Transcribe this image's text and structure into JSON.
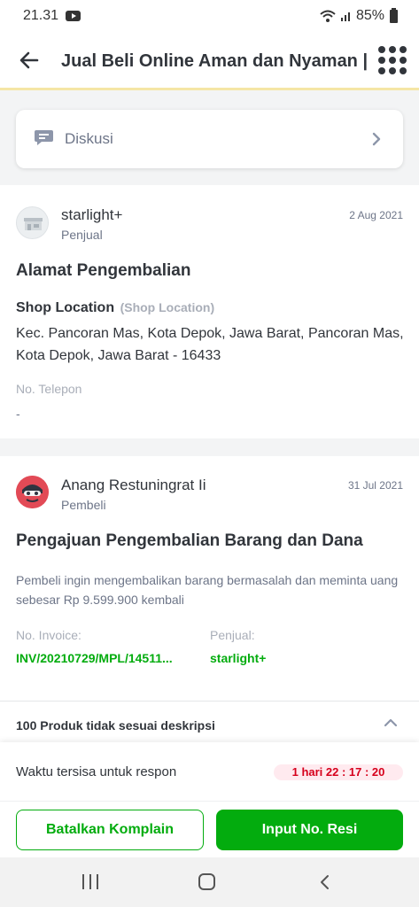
{
  "status_bar": {
    "time": "21.31",
    "battery": "85%"
  },
  "app_bar": {
    "title": "Jual Beli Online Aman dan Nyaman |..."
  },
  "discussion": {
    "label": "Diskusi"
  },
  "seller_post": {
    "name": "starlight+",
    "role": "Penjual",
    "date": "2 Aug 2021",
    "title": "Alamat Pengembalian",
    "shop_location": "Shop Location",
    "shop_location_sub": "(Shop Location)",
    "address": "Kec. Pancoran Mas, Kota Depok, Jawa Barat, Pancoran Mas, Kota Depok, Jawa Barat - 16433",
    "phone_label": "No. Telepon",
    "phone_value": "-"
  },
  "buyer_post": {
    "name": "Anang Restuningrat Ii",
    "role": "Pembeli",
    "date": "31 Jul 2021",
    "title": "Pengajuan Pengembalian Barang dan Dana",
    "description": "Pembeli ingin mengembalikan barang bermasalah dan meminta uang sebesar Rp 9.599.900 kembali",
    "invoice_label": "No. Invoice:",
    "invoice_value": "INV/20210729/MPL/14511...",
    "seller_label": "Penjual:",
    "seller_value": "starlight+",
    "product_issue": "100 Produk tidak sesuai deskripsi"
  },
  "response": {
    "label": "Waktu tersisa untuk respon",
    "timer": "1 hari 22 : 17 : 20"
  },
  "actions": {
    "cancel_label": "Batalkan Komplain",
    "input_label": "Input No. Resi"
  },
  "colors": {
    "primary_green": "#03ac0e",
    "timer_red": "#d6001c",
    "header_accent": "#f5e6a6"
  },
  "icons": [
    "back-arrow-icon",
    "grid-menu-icon",
    "chat-bubble-icon",
    "chevron-right-icon",
    "chevron-up-icon",
    "wifi-icon",
    "signal-icon",
    "battery-icon",
    "youtube-icon"
  ]
}
